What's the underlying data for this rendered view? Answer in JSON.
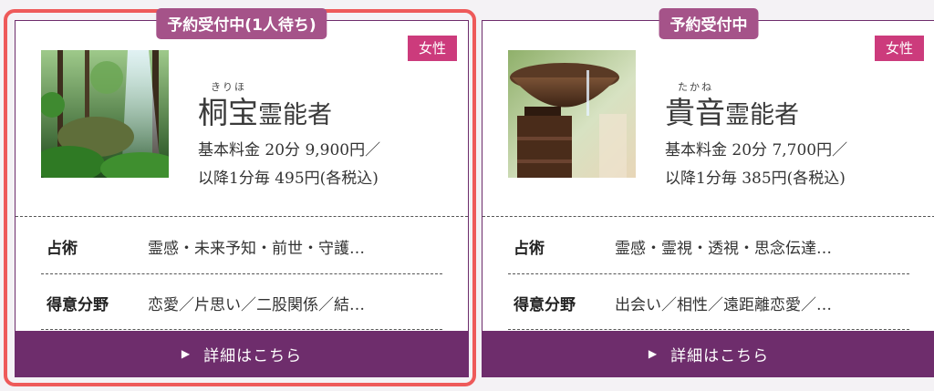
{
  "cards": [
    {
      "status": "予約受付中(1人待ち)",
      "gender": "女性",
      "ruby": "きりほ",
      "name": "桐宝",
      "title_suffix": "霊能者",
      "price_line1": "基本料金 20分 9,900円／",
      "price_line2": "以降1分毎 495円(各税込)",
      "divination_label": "占術",
      "divination_value": "霊感・未来予知・前世・守護…",
      "specialty_label": "得意分野",
      "specialty_value": "恋愛／片思い／二股関係／結…",
      "detail_label": "詳細はこちら",
      "photo_icon": "forest-photo"
    },
    {
      "status": "予約受付中",
      "gender": "女性",
      "ruby": "たかね",
      "name": "貴音",
      "title_suffix": "霊能者",
      "price_line1": "基本料金 20分 7,700円／",
      "price_line2": "以降1分毎 385円(各税込)",
      "divination_label": "占術",
      "divination_value": "霊感・霊視・透視・思念伝達…",
      "specialty_label": "得意分野",
      "specialty_value": "出会い／相性／遠距離恋愛／…",
      "detail_label": "詳細はこちら",
      "photo_icon": "stone-basin-photo"
    }
  ],
  "colors": {
    "brand_purple": "#6e2d6c",
    "status_pink": "#a55389",
    "gender_magenta": "#cc3b7c",
    "highlight_red": "#ee5a5a"
  }
}
